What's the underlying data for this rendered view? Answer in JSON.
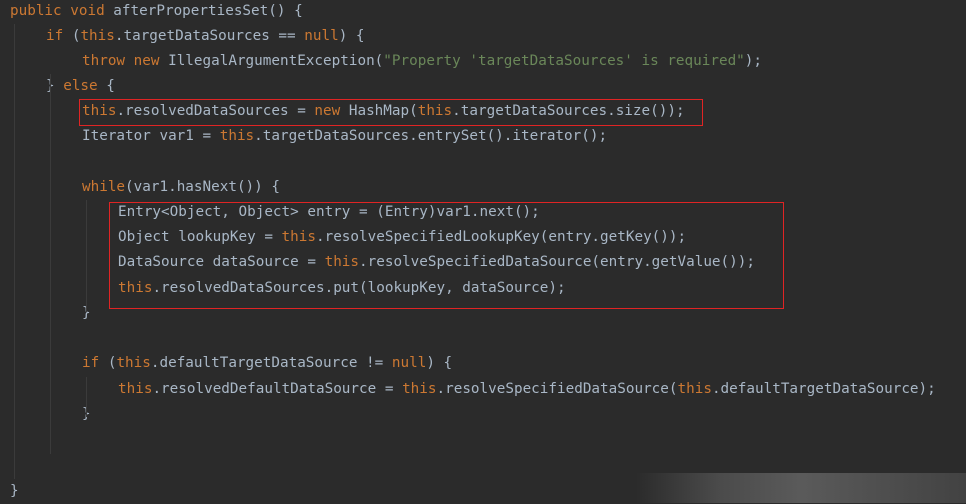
{
  "code": {
    "lines": [
      [
        {
          "t": "public",
          "c": "kw"
        },
        {
          "t": " "
        },
        {
          "t": "void",
          "c": "kw"
        },
        {
          "t": " afterPropertiesSet() {"
        }
      ],
      [
        {
          "t": "if",
          "c": "kw"
        },
        {
          "t": " ("
        },
        {
          "t": "this",
          "c": "kw"
        },
        {
          "t": ".targetDataSources == "
        },
        {
          "t": "null",
          "c": "kw"
        },
        {
          "t": ") {"
        }
      ],
      [
        {
          "t": "throw",
          "c": "kw"
        },
        {
          "t": " "
        },
        {
          "t": "new",
          "c": "kw"
        },
        {
          "t": " IllegalArgumentException("
        },
        {
          "t": "\"Property 'targetDataSources' is required\"",
          "c": "str"
        },
        {
          "t": ");"
        }
      ],
      [
        {
          "t": "} "
        },
        {
          "t": "else",
          "c": "kw"
        },
        {
          "t": " {"
        }
      ],
      [
        {
          "t": "this",
          "c": "kw"
        },
        {
          "t": ".resolvedDataSources = "
        },
        {
          "t": "new",
          "c": "kw"
        },
        {
          "t": " HashMap("
        },
        {
          "t": "this",
          "c": "kw"
        },
        {
          "t": ".targetDataSources.size());"
        }
      ],
      [
        {
          "t": "Iterator var1 = "
        },
        {
          "t": "this",
          "c": "kw"
        },
        {
          "t": ".targetDataSources.entrySet().iterator();"
        }
      ],
      [],
      [
        {
          "t": "while",
          "c": "kw"
        },
        {
          "t": "(var1.hasNext()) {"
        }
      ],
      [
        {
          "t": "Entry<Object, Object> entry = (Entry)var1.next();"
        }
      ],
      [
        {
          "t": "Object lookupKey = "
        },
        {
          "t": "this",
          "c": "kw"
        },
        {
          "t": ".resolveSpecifiedLookupKey(entry.getKey());"
        }
      ],
      [
        {
          "t": "DataSource dataSource = "
        },
        {
          "t": "this",
          "c": "kw"
        },
        {
          "t": ".resolveSpecifiedDataSource(entry.getValue());"
        }
      ],
      [
        {
          "t": "this",
          "c": "kw"
        },
        {
          "t": ".resolvedDataSources.put(lookupKey, dataSource);"
        }
      ],
      [
        {
          "t": "}"
        }
      ],
      [],
      [
        {
          "t": "if",
          "c": "kw"
        },
        {
          "t": " ("
        },
        {
          "t": "this",
          "c": "kw"
        },
        {
          "t": ".defaultTargetDataSource != "
        },
        {
          "t": "null",
          "c": "kw"
        },
        {
          "t": ") {"
        }
      ],
      [
        {
          "t": "this",
          "c": "kw"
        },
        {
          "t": ".resolvedDefaultDataSource = "
        },
        {
          "t": "this",
          "c": "kw"
        },
        {
          "t": ".resolveSpecifiedDataSource("
        },
        {
          "t": "this",
          "c": "kw"
        },
        {
          "t": ".defaultTargetDataSource);"
        }
      ],
      [
        {
          "t": "}"
        }
      ],
      [],
      [],
      [
        {
          "t": "}"
        }
      ]
    ],
    "indent_levels": [
      0,
      1,
      2,
      1,
      2,
      2,
      0,
      2,
      3,
      3,
      3,
      3,
      2,
      0,
      2,
      3,
      2,
      0,
      0,
      1
    ],
    "highlight_color": "#e02424",
    "keyword_color": "#cc7832",
    "string_color": "#6a8759",
    "text_color": "#a9b7c6"
  },
  "closing_brace": "}"
}
